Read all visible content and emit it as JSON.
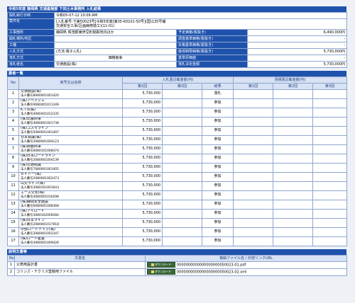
{
  "page": {
    "title": "令和5年度 静岡県 交通基盤部 下田土木事務所 入札結果"
  },
  "info": {
    "rows": [
      {
        "label": "開札執行日時",
        "value": "令和05-07-12 10:09 AM"
      },
      {
        "label": "案件名",
        "value": "[入札番号:下第50023号]令和5年度[第35-K0101-50号](国)135号補\n交通安全工事(区画線修繕工)(11-01)"
      },
      {
        "label": "工事箇所",
        "value": "静岡県 賀茂郡東伊豆町稲取地内ほか",
        "label2": "予定価格(税抜き)",
        "value2": "6,490,000円"
      },
      {
        "label": "開札場所/地区",
        "value": "",
        "label2": "調査基準価格(税抜き)",
        "value2": "-"
      },
      {
        "label": "工種",
        "value": "",
        "label2": "失格基準価格(税抜き)",
        "value2": "-"
      },
      {
        "label": "入札方式",
        "value": "(方法:電子入札)",
        "label2": "最低制限価格(税抜き)",
        "value2": "5,730,000円"
      },
      {
        "label": "落札方式",
        "value": "価格競争",
        "label2": "基準評価値",
        "value2": "-"
      },
      {
        "label": "落札者名",
        "value": "交通施設(株)",
        "label2": "落札決定金額",
        "value2": "5,730,000円"
      }
    ]
  },
  "bidders": {
    "section_title": "業者一覧",
    "headers": {
      "no": "No",
      "name": "商号又は名称",
      "group1": "入札書記載金額(円)",
      "group2": "見積書記載金額(円)",
      "r1": "第1回",
      "r2": "第2回",
      "r3": "第3回",
      "result": "結果"
    },
    "rows": [
      {
        "no": "1",
        "name": "交通施設(株)",
        "reg": "法人番号8080001001420",
        "amount": "5,730,000",
        "result": "落札"
      },
      {
        "no": "2",
        "name": "(株)アペックス",
        "reg": "法人番号9080401011349",
        "amount": "5,730,000",
        "result": "参加"
      },
      {
        "no": "3",
        "name": "K.T.S(株)",
        "reg": "法人番号4080401012335",
        "amount": "5,730,000",
        "result": "参加"
      },
      {
        "no": "4",
        "name": "(株)北藤商事",
        "reg": "法人番号4080001001738",
        "amount": "5,730,000",
        "result": "参加"
      },
      {
        "no": "5",
        "name": "(株)コスモライン",
        "reg": "法人番号5080001001497",
        "amount": "5,730,000",
        "result": "参加"
      },
      {
        "no": "6",
        "name": "日本標識(株)",
        "reg": "法人番号2080001004123",
        "amount": "5,730,000",
        "result": "参加"
      },
      {
        "no": "7",
        "name": "(株)興亜商事",
        "reg": "法人番号6080101008474",
        "amount": "5,730,000",
        "result": "参加"
      },
      {
        "no": "8",
        "name": "(株)日本ロードライン",
        "reg": "法人番号2080001004139",
        "amount": "5,730,000",
        "result": "参加"
      },
      {
        "no": "9",
        "name": "(株)交通標識",
        "reg": "法人番号7080001001405",
        "amount": "5,730,000",
        "result": "参加"
      },
      {
        "no": "10",
        "name": "セイトー(株)",
        "reg": "法人番号2080001002473",
        "amount": "5,730,000",
        "result": "参加"
      },
      {
        "no": "11",
        "name": "山交ライン(株)",
        "reg": "法人番号3080101001643",
        "amount": "5,730,000",
        "result": "参加"
      },
      {
        "no": "12",
        "name": "エース交安(株)",
        "reg": "法人番号4080001016298",
        "amount": "5,730,000",
        "result": "参加"
      },
      {
        "no": "13",
        "name": "(株)静岡安全施設",
        "reg": "法人番号6080001008368",
        "amount": "5,730,000",
        "result": "参加"
      },
      {
        "no": "14",
        "name": "(株)アイロード",
        "reg": "法人番号3080102009284",
        "amount": "5,730,000",
        "result": "参加"
      },
      {
        "no": "15",
        "name": "(株)日本ライン",
        "reg": "法人番号2080001017918",
        "amount": "5,730,000",
        "result": "参加"
      },
      {
        "no": "16",
        "name": "中部ロードテック(株)",
        "reg": "法人番号3080001003347",
        "amount": "5,730,000",
        "result": "参加"
      },
      {
        "no": "17",
        "name": "(株)ロード産業",
        "reg": "法人番号4080001009426",
        "amount": "5,730,000",
        "result": "参加"
      }
    ]
  },
  "documents": {
    "section_title": "説明文書等",
    "headers": {
      "no": "No",
      "name": "文書名",
      "file": "格納ファイル名 / 外部リンクURL"
    },
    "download_label": "ダウンロード",
    "rows": [
      {
        "no": "1",
        "name": "公表用設計書",
        "file": "0000000000000000000050023-01.pdf"
      },
      {
        "no": "2",
        "name": "コリンズ・テクリス登録用ファイル",
        "file": "0000000000000000000050023-02.xml"
      }
    ]
  }
}
